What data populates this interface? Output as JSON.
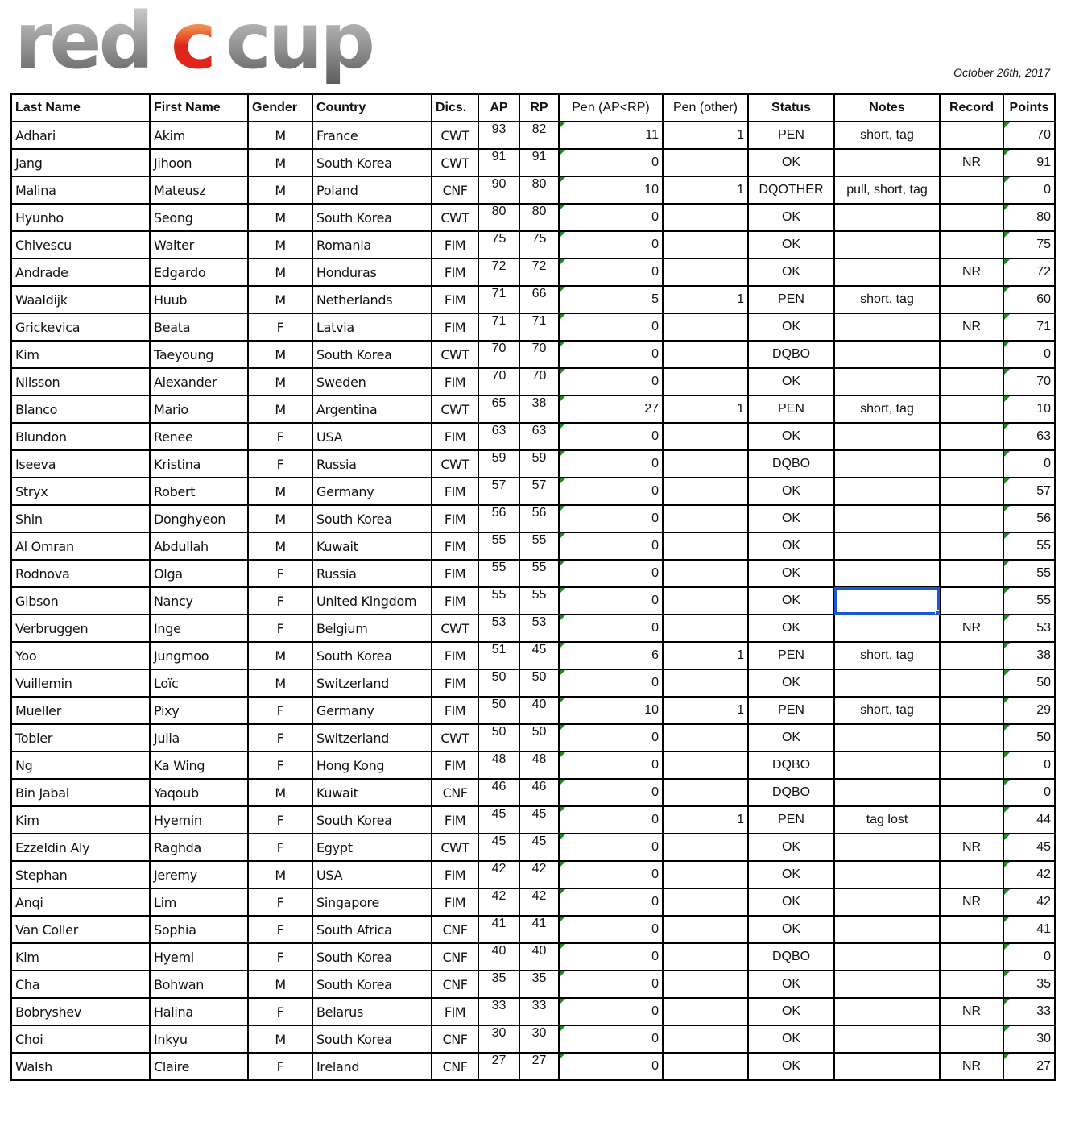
{
  "header": {
    "logo_text_left": "red",
    "logo_text_accent": "c",
    "logo_text_right": "cup",
    "date": "October 26th, 2017"
  },
  "colors": {
    "logo_gray": "#8a8a8a",
    "logo_red": "#e0261b",
    "logo_orange": "#f0a060",
    "flag_green": "#1f8a1f",
    "selection_blue": "#1a56d6"
  },
  "table": {
    "columns": [
      "Last Name",
      "First Name",
      "Gender",
      "Country",
      "Dics.",
      "AP",
      "RP",
      "Pen (AP<RP)",
      "Pen (other)",
      "Status",
      "Notes",
      "Record",
      "Points"
    ],
    "selected_cell": {
      "row": 17,
      "column": "Notes"
    },
    "rows": [
      {
        "last": "Adhari",
        "first": "Akim",
        "gender": "M",
        "country": "France",
        "disc": "CWT",
        "ap": "93",
        "rp": "82",
        "pen_ap_rp": "11",
        "pen_other": "1",
        "status": "PEN",
        "notes": "short, tag",
        "record": "",
        "points": "70"
      },
      {
        "last": "Jang",
        "first": "Jihoon",
        "gender": "M",
        "country": "South Korea",
        "disc": "CWT",
        "ap": "91",
        "rp": "91",
        "pen_ap_rp": "0",
        "pen_other": "",
        "status": "OK",
        "notes": "",
        "record": "NR",
        "points": "91"
      },
      {
        "last": "Malina",
        "first": "Mateusz",
        "gender": "M",
        "country": "Poland",
        "disc": "CNF",
        "ap": "90",
        "rp": "80",
        "pen_ap_rp": "10",
        "pen_other": "1",
        "status": "DQOTHER",
        "notes": "pull, short, tag",
        "record": "",
        "points": "0"
      },
      {
        "last": "Hyunho",
        "first": "Seong",
        "gender": "M",
        "country": "South Korea",
        "disc": "CWT",
        "ap": "80",
        "rp": "80",
        "pen_ap_rp": "0",
        "pen_other": "",
        "status": "OK",
        "notes": "",
        "record": "",
        "points": "80"
      },
      {
        "last": "Chivescu",
        "first": "Walter",
        "gender": "M",
        "country": "Romania",
        "disc": "FIM",
        "ap": "75",
        "rp": "75",
        "pen_ap_rp": "0",
        "pen_other": "",
        "status": "OK",
        "notes": "",
        "record": "",
        "points": "75"
      },
      {
        "last": "Andrade",
        "first": "Edgardo",
        "gender": "M",
        "country": "Honduras",
        "disc": "FIM",
        "ap": "72",
        "rp": "72",
        "pen_ap_rp": "0",
        "pen_other": "",
        "status": "OK",
        "notes": "",
        "record": "NR",
        "points": "72"
      },
      {
        "last": "Waaldijk",
        "first": "Huub",
        "gender": "M",
        "country": "Netherlands",
        "disc": "FIM",
        "ap": "71",
        "rp": "66",
        "pen_ap_rp": "5",
        "pen_other": "1",
        "status": "PEN",
        "notes": "short, tag",
        "record": "",
        "points": "60"
      },
      {
        "last": "Grickevica",
        "first": "Beata",
        "gender": "F",
        "country": "Latvia",
        "disc": "FIM",
        "ap": "71",
        "rp": "71",
        "pen_ap_rp": "0",
        "pen_other": "",
        "status": "OK",
        "notes": "",
        "record": "NR",
        "points": "71"
      },
      {
        "last": "Kim",
        "first": "Taeyoung",
        "gender": "M",
        "country": "South Korea",
        "disc": "CWT",
        "ap": "70",
        "rp": "70",
        "pen_ap_rp": "0",
        "pen_other": "",
        "status": "DQBO",
        "notes": "",
        "record": "",
        "points": "0"
      },
      {
        "last": "Nilsson",
        "first": "Alexander",
        "gender": "M",
        "country": "Sweden",
        "disc": "FIM",
        "ap": "70",
        "rp": "70",
        "pen_ap_rp": "0",
        "pen_other": "",
        "status": "OK",
        "notes": "",
        "record": "",
        "points": "70"
      },
      {
        "last": "Blanco",
        "first": "Mario",
        "gender": "M",
        "country": "Argentina",
        "disc": "CWT",
        "ap": "65",
        "rp": "38",
        "pen_ap_rp": "27",
        "pen_other": "1",
        "status": "PEN",
        "notes": "short, tag",
        "record": "",
        "points": "10"
      },
      {
        "last": "Blundon",
        "first": "Renee",
        "gender": "F",
        "country": "USA",
        "disc": "FIM",
        "ap": "63",
        "rp": "63",
        "pen_ap_rp": "0",
        "pen_other": "",
        "status": "OK",
        "notes": "",
        "record": "",
        "points": "63"
      },
      {
        "last": "Iseeva",
        "first": "Kristina",
        "gender": "F",
        "country": "Russia",
        "disc": "CWT",
        "ap": "59",
        "rp": "59",
        "pen_ap_rp": "0",
        "pen_other": "",
        "status": "DQBO",
        "notes": "",
        "record": "",
        "points": "0"
      },
      {
        "last": "Stryx",
        "first": "Robert",
        "gender": "M",
        "country": "Germany",
        "disc": "FIM",
        "ap": "57",
        "rp": "57",
        "pen_ap_rp": "0",
        "pen_other": "",
        "status": "OK",
        "notes": "",
        "record": "",
        "points": "57"
      },
      {
        "last": "Shin",
        "first": "Donghyeon",
        "gender": "M",
        "country": "South Korea",
        "disc": "FIM",
        "ap": "56",
        "rp": "56",
        "pen_ap_rp": "0",
        "pen_other": "",
        "status": "OK",
        "notes": "",
        "record": "",
        "points": "56"
      },
      {
        "last": "Al Omran",
        "first": "Abdullah",
        "gender": "M",
        "country": "Kuwait",
        "disc": "FIM",
        "ap": "55",
        "rp": "55",
        "pen_ap_rp": "0",
        "pen_other": "",
        "status": "OK",
        "notes": "",
        "record": "",
        "points": "55"
      },
      {
        "last": "Rodnova",
        "first": "Olga",
        "gender": "F",
        "country": "Russia",
        "disc": "FIM",
        "ap": "55",
        "rp": "55",
        "pen_ap_rp": "0",
        "pen_other": "",
        "status": "OK",
        "notes": "",
        "record": "",
        "points": "55"
      },
      {
        "last": "Gibson",
        "first": "Nancy",
        "gender": "F",
        "country": "United Kingdom",
        "disc": "FIM",
        "ap": "55",
        "rp": "55",
        "pen_ap_rp": "0",
        "pen_other": "",
        "status": "OK",
        "notes": "",
        "record": "",
        "points": "55"
      },
      {
        "last": "Verbruggen",
        "first": "Inge",
        "gender": "F",
        "country": "Belgium",
        "disc": "CWT",
        "ap": "53",
        "rp": "53",
        "pen_ap_rp": "0",
        "pen_other": "",
        "status": "OK",
        "notes": "",
        "record": "NR",
        "points": "53"
      },
      {
        "last": "Yoo",
        "first": "Jungmoo",
        "gender": "M",
        "country": "South Korea",
        "disc": "FIM",
        "ap": "51",
        "rp": "45",
        "pen_ap_rp": "6",
        "pen_other": "1",
        "status": "PEN",
        "notes": "short, tag",
        "record": "",
        "points": "38"
      },
      {
        "last": "Vuillemin",
        "first": "Loïc",
        "gender": "M",
        "country": "Switzerland",
        "disc": "FIM",
        "ap": "50",
        "rp": "50",
        "pen_ap_rp": "0",
        "pen_other": "",
        "status": "OK",
        "notes": "",
        "record": "",
        "points": "50"
      },
      {
        "last": "Mueller",
        "first": "Pixy",
        "gender": "F",
        "country": "Germany",
        "disc": "FIM",
        "ap": "50",
        "rp": "40",
        "pen_ap_rp": "10",
        "pen_other": "1",
        "status": "PEN",
        "notes": "short, tag",
        "record": "",
        "points": "29"
      },
      {
        "last": "Tobler",
        "first": "Julia",
        "gender": "F",
        "country": "Switzerland",
        "disc": "CWT",
        "ap": "50",
        "rp": "50",
        "pen_ap_rp": "0",
        "pen_other": "",
        "status": "OK",
        "notes": "",
        "record": "",
        "points": "50"
      },
      {
        "last": "Ng",
        "first": "Ka Wing",
        "gender": "F",
        "country": "Hong Kong",
        "disc": "FIM",
        "ap": "48",
        "rp": "48",
        "pen_ap_rp": "0",
        "pen_other": "",
        "status": "DQBO",
        "notes": "",
        "record": "",
        "points": "0"
      },
      {
        "last": "Bin Jabal",
        "first": "Yaqoub",
        "gender": "M",
        "country": "Kuwait",
        "disc": "CNF",
        "ap": "46",
        "rp": "46",
        "pen_ap_rp": "0",
        "pen_other": "",
        "status": "DQBO",
        "notes": "",
        "record": "",
        "points": "0"
      },
      {
        "last": "Kim",
        "first": "Hyemin",
        "gender": "F",
        "country": "South Korea",
        "disc": "FIM",
        "ap": "45",
        "rp": "45",
        "pen_ap_rp": "0",
        "pen_other": "1",
        "status": "PEN",
        "notes": "tag lost",
        "record": "",
        "points": "44"
      },
      {
        "last": "Ezzeldin Aly",
        "first": "Raghda",
        "gender": "F",
        "country": "Egypt",
        "disc": "CWT",
        "ap": "45",
        "rp": "45",
        "pen_ap_rp": "0",
        "pen_other": "",
        "status": "OK",
        "notes": "",
        "record": "NR",
        "points": "45"
      },
      {
        "last": "Stephan",
        "first": "Jeremy",
        "gender": "M",
        "country": "USA",
        "disc": "FIM",
        "ap": "42",
        "rp": "42",
        "pen_ap_rp": "0",
        "pen_other": "",
        "status": "OK",
        "notes": "",
        "record": "",
        "points": "42"
      },
      {
        "last": "Anqi",
        "first": "Lim",
        "gender": "F",
        "country": "Singapore",
        "disc": "FIM",
        "ap": "42",
        "rp": "42",
        "pen_ap_rp": "0",
        "pen_other": "",
        "status": "OK",
        "notes": "",
        "record": "NR",
        "points": "42"
      },
      {
        "last": "Van Coller",
        "first": "Sophia",
        "gender": "F",
        "country": "South Africa",
        "disc": "CNF",
        "ap": "41",
        "rp": "41",
        "pen_ap_rp": "0",
        "pen_other": "",
        "status": "OK",
        "notes": "",
        "record": "",
        "points": "41"
      },
      {
        "last": "Kim",
        "first": "Hyemi",
        "gender": "F",
        "country": "South Korea",
        "disc": "CNF",
        "ap": "40",
        "rp": "40",
        "pen_ap_rp": "0",
        "pen_other": "",
        "status": "DQBO",
        "notes": "",
        "record": "",
        "points": "0"
      },
      {
        "last": "Cha",
        "first": "Bohwan",
        "gender": "M",
        "country": "South Korea",
        "disc": "CNF",
        "ap": "35",
        "rp": "35",
        "pen_ap_rp": "0",
        "pen_other": "",
        "status": "OK",
        "notes": "",
        "record": "",
        "points": "35"
      },
      {
        "last": "Bobryshev",
        "first": "Halina",
        "gender": "F",
        "country": "Belarus",
        "disc": "FIM",
        "ap": "33",
        "rp": "33",
        "pen_ap_rp": "0",
        "pen_other": "",
        "status": "OK",
        "notes": "",
        "record": "NR",
        "points": "33"
      },
      {
        "last": "Choi",
        "first": "Inkyu",
        "gender": "M",
        "country": "South Korea",
        "disc": "CNF",
        "ap": "30",
        "rp": "30",
        "pen_ap_rp": "0",
        "pen_other": "",
        "status": "OK",
        "notes": "",
        "record": "",
        "points": "30"
      },
      {
        "last": "Walsh",
        "first": "Claire",
        "gender": "F",
        "country": "Ireland",
        "disc": "CNF",
        "ap": "27",
        "rp": "27",
        "pen_ap_rp": "0",
        "pen_other": "",
        "status": "OK",
        "notes": "",
        "record": "NR",
        "points": "27"
      }
    ]
  }
}
